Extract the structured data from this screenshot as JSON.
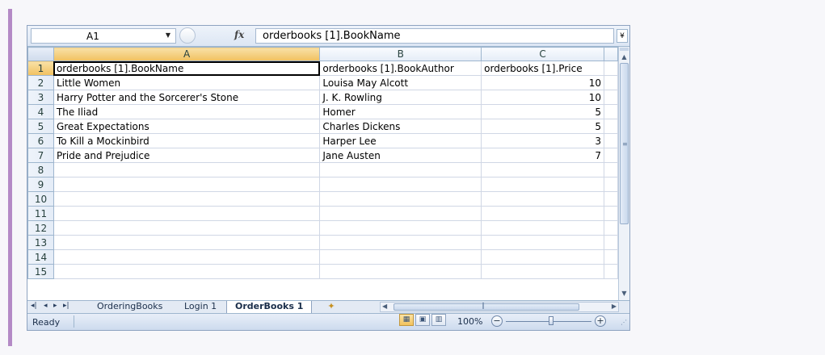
{
  "name_box": {
    "value": "A1"
  },
  "formula_bar": {
    "fx_label": "fx",
    "value": "orderbooks [1].BookName"
  },
  "columns": [
    "A",
    "B",
    "C"
  ],
  "row_numbers": [
    "1",
    "2",
    "3",
    "4",
    "5",
    "6",
    "7",
    "8",
    "9",
    "10",
    "11",
    "12",
    "13",
    "14",
    "15"
  ],
  "rows": [
    [
      "orderbooks [1].BookName",
      "orderbooks [1].BookAuthor",
      "orderbooks [1].Price"
    ],
    [
      "Little Women",
      "Louisa May Alcott",
      "10"
    ],
    [
      "Harry Potter and the Sorcerer's Stone",
      "J. K. Rowling",
      "10"
    ],
    [
      "The Iliad",
      "Homer",
      "5"
    ],
    [
      "Great Expectations",
      "Charles Dickens",
      "5"
    ],
    [
      "To Kill a Mockinbird",
      "Harper Lee",
      "3"
    ],
    [
      "Pride and Prejudice",
      "Jane Austen",
      "7"
    ],
    [
      "",
      "",
      ""
    ],
    [
      "",
      "",
      ""
    ],
    [
      "",
      "",
      ""
    ],
    [
      "",
      "",
      ""
    ],
    [
      "",
      "",
      ""
    ],
    [
      "",
      "",
      ""
    ],
    [
      "",
      "",
      ""
    ],
    [
      "",
      "",
      ""
    ]
  ],
  "sheet_tabs": [
    "OrderingBooks",
    "Login 1",
    "OrderBooks 1"
  ],
  "active_sheet": "OrderBooks 1",
  "status": {
    "text": "Ready",
    "zoom": "100%"
  },
  "colors": {
    "accent": "#b48ac6",
    "selection_header": "#f1c15f",
    "grid_line": "#d0d7e5"
  }
}
